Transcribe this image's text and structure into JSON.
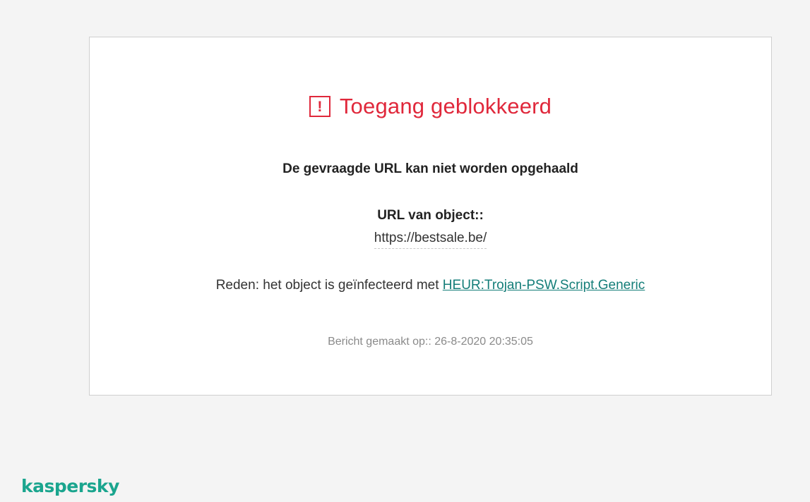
{
  "page": {
    "title": "Toegang geblokkeerd",
    "headline": "De gevraagde URL kan niet worden opgehaald",
    "url_label": "URL van object::",
    "url_value": "https://bestsale.be/",
    "reason_prefix": "Reden: het object is geïnfecteerd met",
    "threat_name": "HEUR:Trojan-PSW.Script.Generic",
    "timestamp": "Bericht gemaakt op:: 26-8-2020 20:35:05"
  },
  "icons": {
    "warning": "warning-icon",
    "warning_glyph": "!"
  },
  "brand": {
    "logo": "kaspersky"
  },
  "colors": {
    "alert_red": "#e0283b",
    "link_teal": "#137d78",
    "brand_green": "#1aa58e",
    "background": "#f4f4f4"
  }
}
